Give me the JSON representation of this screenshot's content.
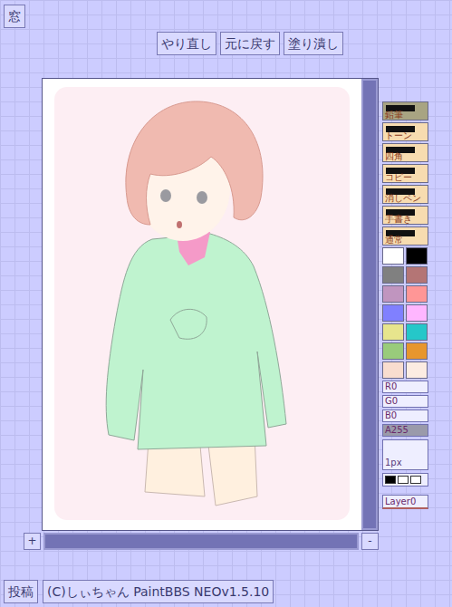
{
  "window_button": "窓",
  "toolbar": [
    "やり直し",
    "元に戻す",
    "塗り潰し"
  ],
  "tools": [
    {
      "label": "鉛筆",
      "selected": true
    },
    {
      "label": "トーン",
      "selected": false
    },
    {
      "label": "四角",
      "selected": false
    },
    {
      "label": "コピー",
      "selected": false
    },
    {
      "label": "消しペン",
      "selected": false
    },
    {
      "label": "手書き",
      "selected": false
    },
    {
      "label": "通常",
      "selected": false
    }
  ],
  "palette": [
    {
      "color": "#ffffff"
    },
    {
      "color": "#000000"
    },
    {
      "color": "#808080"
    },
    {
      "color": "#b47575"
    },
    {
      "color": "#c095bf"
    },
    {
      "color": "#ff9696"
    },
    {
      "color": "#8080ff"
    },
    {
      "color": "#ffb6ff"
    },
    {
      "color": "#e7e58d"
    },
    {
      "color": "#25c7c9"
    },
    {
      "color": "#99cb7b"
    },
    {
      "color": "#e7962d"
    },
    {
      "color": "#f9ddcf"
    },
    {
      "color": "#fcece2"
    }
  ],
  "sliders": [
    {
      "label": "R0",
      "level": 0
    },
    {
      "label": "G0",
      "level": 0
    },
    {
      "label": "B0",
      "level": 0
    },
    {
      "label": "A255",
      "level": 1
    }
  ],
  "pen_size": "1px",
  "line_widths": [
    {
      "selected": true
    },
    {
      "selected": false
    },
    {
      "selected": false
    }
  ],
  "layer": "Layer0",
  "scroll": {
    "plus": "+",
    "minus": "-"
  },
  "footer": {
    "submit": "投稿",
    "credit": "(C)しぃちゃん PaintBBS NEOv1.5.10"
  }
}
